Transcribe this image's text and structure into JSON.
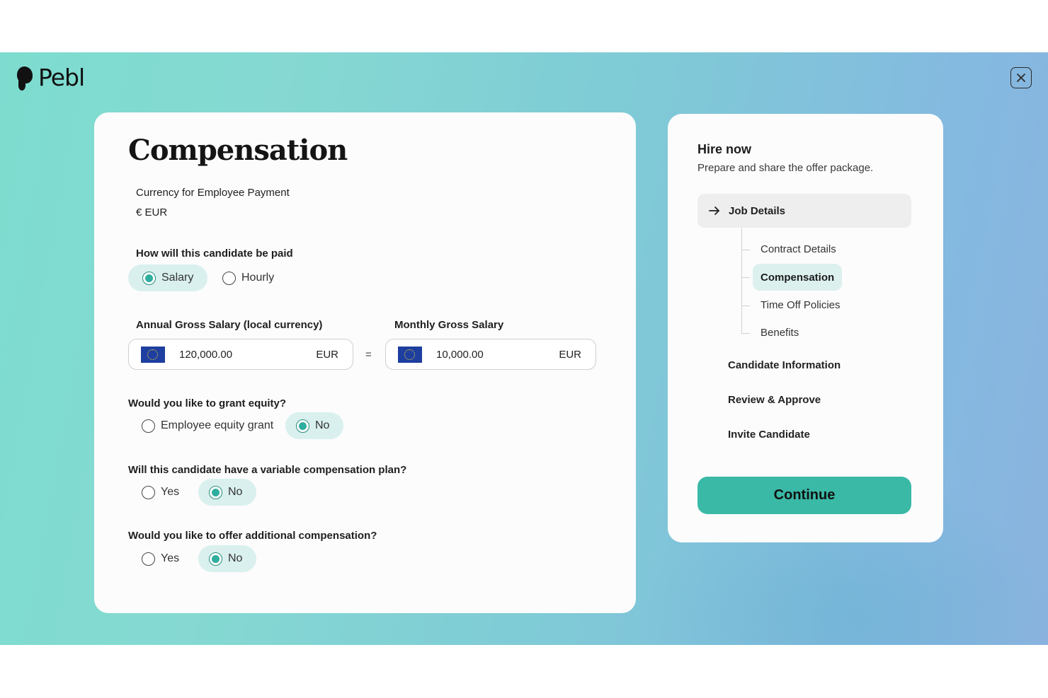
{
  "brand": {
    "name": "Pebl"
  },
  "page": {
    "title": "Compensation"
  },
  "currency": {
    "label": "Currency for Employee Payment",
    "value": "€ EUR"
  },
  "pay_type": {
    "question": "How will this candidate be paid",
    "options": [
      {
        "label": "Salary",
        "selected": true
      },
      {
        "label": "Hourly",
        "selected": false
      }
    ]
  },
  "salary": {
    "annual_label": "Annual Gross Salary (local currency)",
    "annual_value": "120,000.00",
    "annual_currency": "EUR",
    "equals": "=",
    "monthly_label": "Monthly Gross Salary",
    "monthly_value": "10,000.00",
    "monthly_currency": "EUR"
  },
  "equity": {
    "question": "Would you like to grant equity?",
    "options": [
      {
        "label": "Employee equity grant",
        "selected": false
      },
      {
        "label": "No",
        "selected": true
      }
    ]
  },
  "variable_comp": {
    "question": "Will this candidate have a variable compensation plan?",
    "options": [
      {
        "label": "Yes",
        "selected": false
      },
      {
        "label": "No",
        "selected": true
      }
    ]
  },
  "additional_comp": {
    "question": "Would you like to offer additional compensation?",
    "options": [
      {
        "label": "Yes",
        "selected": false
      },
      {
        "label": "No",
        "selected": true
      }
    ]
  },
  "sidebar": {
    "title": "Hire now",
    "subtitle": "Prepare and share the offer package.",
    "active_step": "Job Details",
    "sub_steps": [
      "Contract Details",
      "Compensation",
      "Time Off Policies",
      "Benefits"
    ],
    "current_sub_step": "Compensation",
    "steps": [
      "Candidate Information",
      "Review & Approve",
      "Invite Candidate"
    ],
    "continue_label": "Continue"
  },
  "colors": {
    "accent": "#3bb9a7",
    "selected_bg": "#d9f0ee",
    "radio_dot": "#2fae9f",
    "eu_blue": "#1e3fa0",
    "eu_star": "#f3d232"
  },
  "icons": {
    "close": "close-icon",
    "arrow": "arrow-right-icon",
    "flag": "eu-flag-icon"
  }
}
